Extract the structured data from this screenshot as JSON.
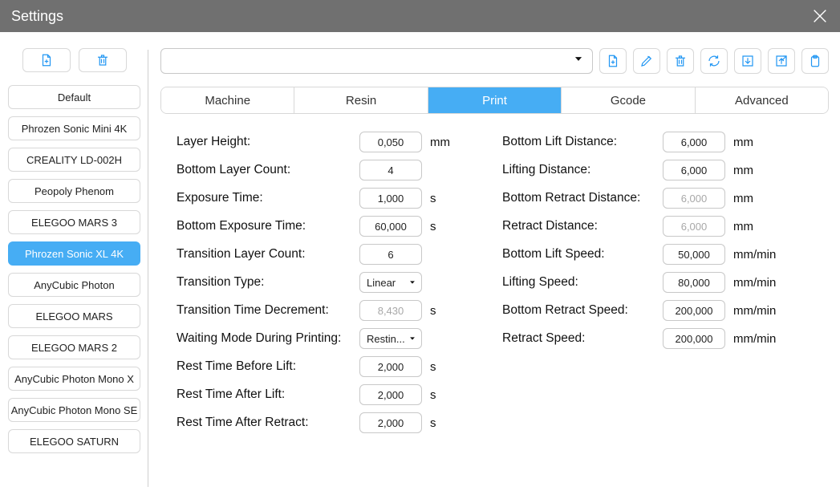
{
  "window": {
    "title": "Settings"
  },
  "sidebar": {
    "profiles": [
      {
        "label": "Default",
        "selected": false
      },
      {
        "label": "Phrozen Sonic Mini 4K",
        "selected": false
      },
      {
        "label": "CREALITY LD-002H",
        "selected": false
      },
      {
        "label": "Peopoly Phenom",
        "selected": false
      },
      {
        "label": "ELEGOO MARS 3",
        "selected": false
      },
      {
        "label": "Phrozen Sonic XL 4K",
        "selected": true
      },
      {
        "label": "AnyCubic Photon",
        "selected": false
      },
      {
        "label": "ELEGOO MARS",
        "selected": false
      },
      {
        "label": "ELEGOO MARS 2",
        "selected": false
      },
      {
        "label": "AnyCubic Photon Mono X",
        "selected": false
      },
      {
        "label": "AnyCubic Photon Mono SE",
        "selected": false
      },
      {
        "label": "ELEGOO SATURN",
        "selected": false
      }
    ]
  },
  "main": {
    "combo_value": "",
    "tabs": [
      {
        "label": "Machine",
        "active": false
      },
      {
        "label": "Resin",
        "active": false
      },
      {
        "label": "Print",
        "active": true
      },
      {
        "label": "Gcode",
        "active": false
      },
      {
        "label": "Advanced",
        "active": false
      }
    ],
    "col1": [
      {
        "label": "Layer Height:",
        "value": "0,050",
        "unit": "mm",
        "type": "text"
      },
      {
        "label": "Bottom Layer Count:",
        "value": "4",
        "unit": "",
        "type": "text"
      },
      {
        "label": "Exposure Time:",
        "value": "1,000",
        "unit": "s",
        "type": "text"
      },
      {
        "label": "Bottom Exposure Time:",
        "value": "60,000",
        "unit": "s",
        "type": "text"
      },
      {
        "label": "Transition Layer Count:",
        "value": "6",
        "unit": "",
        "type": "text"
      },
      {
        "label": "Transition Type:",
        "value": "Linear",
        "unit": "",
        "type": "select"
      },
      {
        "label": "Transition Time Decrement:",
        "value": "8,430",
        "unit": "s",
        "type": "text",
        "disabled": true
      },
      {
        "label": "Waiting Mode During Printing:",
        "value": "Restin...",
        "unit": "",
        "type": "select"
      },
      {
        "label": "Rest Time Before Lift:",
        "value": "2,000",
        "unit": "s",
        "type": "text"
      },
      {
        "label": "Rest Time After Lift:",
        "value": "2,000",
        "unit": "s",
        "type": "text"
      },
      {
        "label": "Rest Time After Retract:",
        "value": "2,000",
        "unit": "s",
        "type": "text"
      }
    ],
    "col2": [
      {
        "label": "Bottom Lift Distance:",
        "value": "6,000",
        "unit": "mm",
        "type": "text"
      },
      {
        "label": "Lifting Distance:",
        "value": "6,000",
        "unit": "mm",
        "type": "text"
      },
      {
        "label": "Bottom Retract Distance:",
        "value": "6,000",
        "unit": "mm",
        "type": "text",
        "disabled": true
      },
      {
        "label": "Retract Distance:",
        "value": "6,000",
        "unit": "mm",
        "type": "text",
        "disabled": true
      },
      {
        "label": "Bottom Lift Speed:",
        "value": "50,000",
        "unit": "mm/min",
        "type": "text"
      },
      {
        "label": "Lifting Speed:",
        "value": "80,000",
        "unit": "mm/min",
        "type": "text"
      },
      {
        "label": "Bottom Retract Speed:",
        "value": "200,000",
        "unit": "mm/min",
        "type": "text"
      },
      {
        "label": "Retract Speed:",
        "value": "200,000",
        "unit": "mm/min",
        "type": "text"
      }
    ]
  },
  "icons": {
    "toolbar": [
      "add-file-icon",
      "edit-icon",
      "trash-icon",
      "refresh-icon",
      "import-icon",
      "export-icon",
      "clipboard-icon"
    ]
  },
  "colors": {
    "accent": "#46ADF4",
    "iconBlue": "#2196F3",
    "titlebar": "#707070"
  }
}
